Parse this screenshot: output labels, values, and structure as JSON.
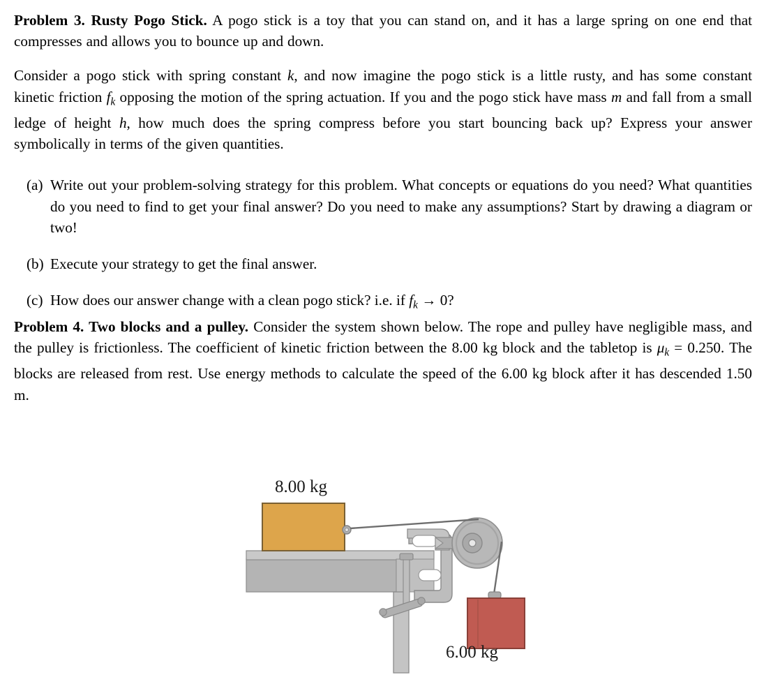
{
  "document": {
    "problem3": {
      "heading": "Problem 3. Rusty Pogo Stick.",
      "intro_rest": " A pogo stick is a toy that you can stand on, and it has a large spring on one end that compresses and allows you to bounce up and down.",
      "paragraph2_part1": "Consider a pogo stick with spring constant ",
      "sym_k": "k",
      "paragraph2_part2": ", and now imagine the pogo stick is a little rusty, and has some constant kinetic friction ",
      "sym_f": "f",
      "sym_f_sub": "k",
      "paragraph2_part3": " opposing the motion of the spring actuation. If you and the pogo stick have mass ",
      "sym_m": "m",
      "paragraph2_part4": " and fall from a small ledge of height ",
      "sym_h": "h",
      "paragraph2_part5": ", how much does the spring compress before you start bouncing back up? Express your answer symbolically in terms of the given quantities.",
      "items": [
        {
          "marker": "(a)",
          "text": "Write out your problem-solving strategy for this problem. What concepts or equations do you need? What quantities do you need to find to get your final answer? Do you need to make any assumptions? Start by drawing a diagram or two!"
        },
        {
          "marker": "(b)",
          "text": "Execute your strategy to get the final answer."
        },
        {
          "marker": "(c)",
          "text_part1": "How does our answer change with a clean pogo stick? i.e. if ",
          "sym_f": "f",
          "sym_f_sub": "k",
          "text_part2": " → 0?"
        }
      ]
    },
    "problem4": {
      "heading": "Problem 4. Two blocks and a pulley.",
      "text_part1": " Consider the system shown below. The rope and pulley have negligible mass, and the pulley is frictionless. The coefficient of kinetic friction between the 8.00 kg block and the tabletop is ",
      "sym_mu": "μ",
      "sym_mu_sub": "k",
      "text_part2": " = 0.250. The blocks are released from rest. Use energy methods to calculate the speed of the 6.00 kg block after it has descended 1.50 m."
    },
    "figure": {
      "block_top_label": "8.00 kg",
      "block_hanging_label": "6.00 kg",
      "colors": {
        "block_top_fill": "#DDA54B",
        "block_top_stroke": "#7A6033",
        "block_hanging_fill": "#C05B52",
        "block_hanging_stroke": "#8A4038",
        "table_top_fill": "#C9C9C9",
        "table_body_fill": "#B4B4B4",
        "table_stroke": "#808080",
        "clamp_fill": "#BDBDBD",
        "clamp_stroke": "#8C8C8C",
        "pulley_fill": "#B8B8B8",
        "pulley_stroke": "#909090",
        "rope_color": "#6E6E6E"
      }
    }
  }
}
